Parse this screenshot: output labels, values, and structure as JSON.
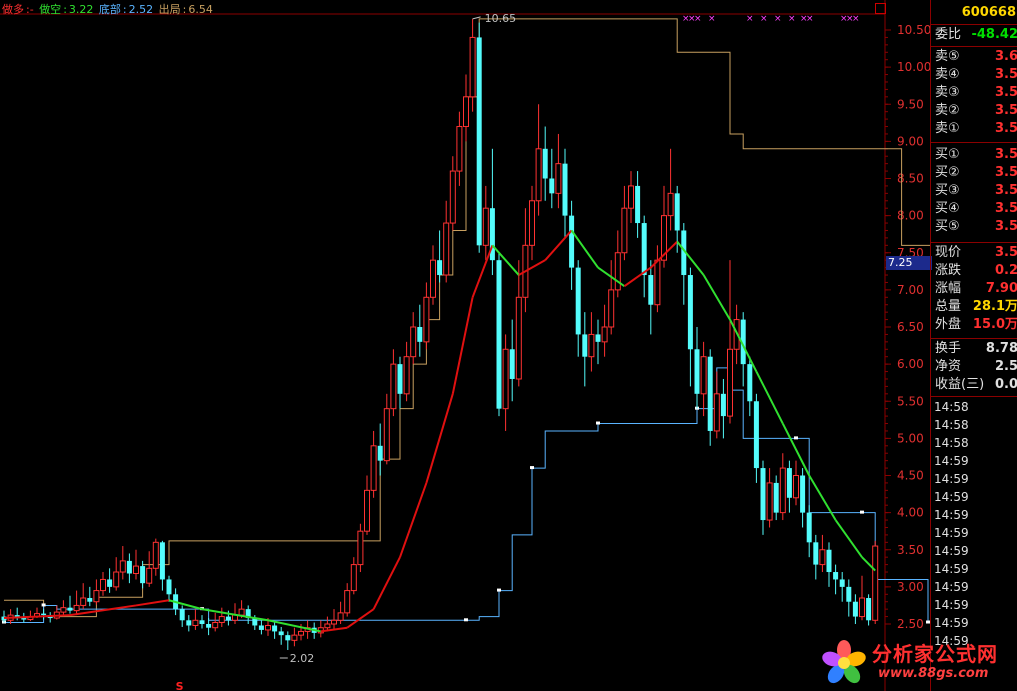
{
  "indicators": {
    "main_label": "做多",
    "main_sep": ":-",
    "short_label": "做空",
    "short_value": "3.22",
    "bottom_label": "底部",
    "bottom_value": "2.52",
    "exit_label": "出局",
    "exit_value": "6.54"
  },
  "price_axis": [
    "10.50",
    "10.00",
    "9.50",
    "9.00",
    "8.50",
    "8.00",
    "7.50",
    "7.00",
    "6.50",
    "6.00",
    "5.50",
    "5.00",
    "4.50",
    "4.00",
    "3.50",
    "3.00",
    "2.50"
  ],
  "annotations": {
    "high_label": "10.65",
    "low_label": "2.02",
    "marker_s": "S",
    "current_tag": "7.25",
    "x_marks": "×××  ×"
  },
  "quote": {
    "code": "600668",
    "rows": [
      {
        "label": "委比",
        "value": "-48.42",
        "color": "#00e000"
      },
      {
        "label": "卖⑤",
        "value": "3.6",
        "color": "#ff3030"
      },
      {
        "label": "卖④",
        "value": "3.5",
        "color": "#ff3030"
      },
      {
        "label": "卖③",
        "value": "3.5",
        "color": "#ff3030"
      },
      {
        "label": "卖②",
        "value": "3.5",
        "color": "#ff3030"
      },
      {
        "label": "卖①",
        "value": "3.5",
        "color": "#ff3030"
      },
      {
        "label": "买①",
        "value": "3.5",
        "color": "#ff3030"
      },
      {
        "label": "买②",
        "value": "3.5",
        "color": "#ff3030"
      },
      {
        "label": "买③",
        "value": "3.5",
        "color": "#ff3030"
      },
      {
        "label": "买④",
        "value": "3.5",
        "color": "#ff3030"
      },
      {
        "label": "买⑤",
        "value": "3.5",
        "color": "#ff3030"
      },
      {
        "label": "现价",
        "value": "3.5",
        "color": "#ff3030"
      },
      {
        "label": "涨跌",
        "value": "0.2",
        "color": "#ff3030"
      },
      {
        "label": "涨幅",
        "value": "7.90",
        "color": "#ff3030"
      },
      {
        "label": "总量",
        "value": "28.1万",
        "color": "#ffd700"
      },
      {
        "label": "外盘",
        "value": "15.0万",
        "color": "#ff3030"
      },
      {
        "label": "换手",
        "value": "8.78",
        "color": "#e0e0e0"
      },
      {
        "label": "净资",
        "value": "2.5",
        "color": "#e0e0e0"
      },
      {
        "label": "收益(三)",
        "value": "0.0",
        "color": "#e0e0e0"
      }
    ],
    "ticks": [
      "14:58",
      "14:58",
      "14:58",
      "14:59",
      "14:59",
      "14:59",
      "14:59",
      "14:59",
      "14:59",
      "14:59",
      "14:59",
      "14:59",
      "14:59",
      "14:59"
    ]
  },
  "watermark": {
    "title": "分析家公式网",
    "url": "www.88gs.com"
  },
  "colors": {
    "up": "#ff3232",
    "down": "#54fcfc",
    "ma_up": "#e01010",
    "ma_down": "#30e030",
    "exit_line": "#c8a060",
    "bottom_line": "#5ab4ff",
    "grid": "#8b0000",
    "marks": "#ff40ff"
  },
  "chart_data": {
    "type": "candlestick",
    "ylim": [
      2.0,
      10.8
    ],
    "candles": [
      [
        2.6,
        2.55,
        2.68,
        2.52
      ],
      [
        2.55,
        2.62,
        2.7,
        2.5
      ],
      [
        2.62,
        2.58,
        2.72,
        2.55
      ],
      [
        2.58,
        2.56,
        2.65,
        2.52
      ],
      [
        2.56,
        2.6,
        2.68,
        2.54
      ],
      [
        2.6,
        2.64,
        2.72,
        2.58
      ],
      [
        2.64,
        2.62,
        2.7,
        2.56
      ],
      [
        2.62,
        2.58,
        2.66,
        2.52
      ],
      [
        2.58,
        2.66,
        2.75,
        2.56
      ],
      [
        2.66,
        2.72,
        2.82,
        2.6
      ],
      [
        2.72,
        2.68,
        2.88,
        2.64
      ],
      [
        2.68,
        2.75,
        2.95,
        2.62
      ],
      [
        2.75,
        2.85,
        3.05,
        2.7
      ],
      [
        2.85,
        2.8,
        3.0,
        2.74
      ],
      [
        2.8,
        2.95,
        3.1,
        2.76
      ],
      [
        2.95,
        3.1,
        3.2,
        2.88
      ],
      [
        3.1,
        3.0,
        3.25,
        2.92
      ],
      [
        3.0,
        3.2,
        3.4,
        2.95
      ],
      [
        3.2,
        3.35,
        3.55,
        3.1
      ],
      [
        3.35,
        3.18,
        3.45,
        3.05
      ],
      [
        3.18,
        3.28,
        3.5,
        3.1
      ],
      [
        3.28,
        3.05,
        3.35,
        2.98
      ],
      [
        3.05,
        3.25,
        3.48,
        3.0
      ],
      [
        3.25,
        3.6,
        3.65,
        3.15
      ],
      [
        3.6,
        3.1,
        3.62,
        2.95
      ],
      [
        3.1,
        2.9,
        3.15,
        2.8
      ],
      [
        2.9,
        2.7,
        2.98,
        2.62
      ],
      [
        2.7,
        2.55,
        2.75,
        2.46
      ],
      [
        2.55,
        2.48,
        2.62,
        2.4
      ],
      [
        2.48,
        2.55,
        2.7,
        2.42
      ],
      [
        2.55,
        2.5,
        2.62,
        2.44
      ],
      [
        2.5,
        2.45,
        2.58,
        2.35
      ],
      [
        2.45,
        2.52,
        2.65,
        2.4
      ],
      [
        2.52,
        2.6,
        2.72,
        2.46
      ],
      [
        2.6,
        2.55,
        2.68,
        2.48
      ],
      [
        2.55,
        2.62,
        2.78,
        2.5
      ],
      [
        2.62,
        2.7,
        2.82,
        2.58
      ],
      [
        2.7,
        2.58,
        2.75,
        2.5
      ],
      [
        2.58,
        2.48,
        2.62,
        2.42
      ],
      [
        2.48,
        2.42,
        2.55,
        2.36
      ],
      [
        2.42,
        2.48,
        2.58,
        2.34
      ],
      [
        2.48,
        2.4,
        2.52,
        2.3
      ],
      [
        2.4,
        2.35,
        2.46,
        2.22
      ],
      [
        2.35,
        2.28,
        2.4,
        2.15
      ],
      [
        2.28,
        2.35,
        2.45,
        2.2
      ],
      [
        2.35,
        2.4,
        2.5,
        2.28
      ],
      [
        2.4,
        2.45,
        2.55,
        2.3
      ],
      [
        2.45,
        2.38,
        2.52,
        2.3
      ],
      [
        2.38,
        2.45,
        2.55,
        2.32
      ],
      [
        2.45,
        2.5,
        2.6,
        2.4
      ],
      [
        2.5,
        2.55,
        2.7,
        2.42
      ],
      [
        2.55,
        2.65,
        2.8,
        2.5
      ],
      [
        2.65,
        2.95,
        3.05,
        2.6
      ],
      [
        2.95,
        3.3,
        3.4,
        2.9
      ],
      [
        3.3,
        3.75,
        3.85,
        3.2
      ],
      [
        3.75,
        4.3,
        4.5,
        3.7
      ],
      [
        4.3,
        4.9,
        5.1,
        4.2
      ],
      [
        4.9,
        4.7,
        5.2,
        4.5
      ],
      [
        4.7,
        5.4,
        5.6,
        4.65
      ],
      [
        5.4,
        6.0,
        6.2,
        5.3
      ],
      [
        6.0,
        5.6,
        6.1,
        5.4
      ],
      [
        5.6,
        6.1,
        6.3,
        5.5
      ],
      [
        6.1,
        6.5,
        6.7,
        6.0
      ],
      [
        6.5,
        6.3,
        6.8,
        6.1
      ],
      [
        6.3,
        6.9,
        7.1,
        6.2
      ],
      [
        6.9,
        7.4,
        7.6,
        6.8
      ],
      [
        7.4,
        7.2,
        7.8,
        7.1
      ],
      [
        7.2,
        7.9,
        8.2,
        7.1
      ],
      [
        7.9,
        8.6,
        8.8,
        7.8
      ],
      [
        8.6,
        9.2,
        9.4,
        8.4
      ],
      [
        9.2,
        9.6,
        9.9,
        9.0
      ],
      [
        9.6,
        10.4,
        10.65,
        9.4
      ],
      [
        10.4,
        7.6,
        10.6,
        7.5
      ],
      [
        7.6,
        8.1,
        8.4,
        7.4
      ],
      [
        8.1,
        7.4,
        8.9,
        7.2
      ],
      [
        7.4,
        5.4,
        7.5,
        5.3
      ],
      [
        5.4,
        6.2,
        6.4,
        5.1
      ],
      [
        6.2,
        5.8,
        6.6,
        5.5
      ],
      [
        5.8,
        6.9,
        7.4,
        5.7
      ],
      [
        6.9,
        7.6,
        8.1,
        6.7
      ],
      [
        7.6,
        8.2,
        8.4,
        7.4
      ],
      [
        8.2,
        8.9,
        9.5,
        8.0
      ],
      [
        8.9,
        8.5,
        9.2,
        8.2
      ],
      [
        8.5,
        8.3,
        8.9,
        8.1
      ],
      [
        8.3,
        8.7,
        9.1,
        8.1
      ],
      [
        8.7,
        8.0,
        8.9,
        7.7
      ],
      [
        8.0,
        7.3,
        8.2,
        7.0
      ],
      [
        7.3,
        6.4,
        7.4,
        6.1
      ],
      [
        6.4,
        6.1,
        6.7,
        5.7
      ],
      [
        6.1,
        6.4,
        6.7,
        5.9
      ],
      [
        6.4,
        6.3,
        6.6,
        6.0
      ],
      [
        6.3,
        6.5,
        6.8,
        6.1
      ],
      [
        6.5,
        7.0,
        7.4,
        6.4
      ],
      [
        7.0,
        7.5,
        7.8,
        6.9
      ],
      [
        7.5,
        8.1,
        8.4,
        7.4
      ],
      [
        8.1,
        8.4,
        8.6,
        7.9
      ],
      [
        8.4,
        7.9,
        8.6,
        7.7
      ],
      [
        7.9,
        7.2,
        8.0,
        6.9
      ],
      [
        7.2,
        6.8,
        7.4,
        6.4
      ],
      [
        6.8,
        7.4,
        7.6,
        6.7
      ],
      [
        7.4,
        8.0,
        8.4,
        7.3
      ],
      [
        8.0,
        8.3,
        8.9,
        7.8
      ],
      [
        8.3,
        7.8,
        8.4,
        7.5
      ],
      [
        7.8,
        7.2,
        7.9,
        6.8
      ],
      [
        7.2,
        6.2,
        7.3,
        5.7
      ],
      [
        6.2,
        5.6,
        6.5,
        5.4
      ],
      [
        5.6,
        6.1,
        6.3,
        5.3
      ],
      [
        6.1,
        5.1,
        6.2,
        4.9
      ],
      [
        5.1,
        5.6,
        5.9,
        5.0
      ],
      [
        5.6,
        5.3,
        5.8,
        5.0
      ],
      [
        5.3,
        6.2,
        7.4,
        5.2
      ],
      [
        6.2,
        6.6,
        6.8,
        6.0
      ],
      [
        6.6,
        6.0,
        6.7,
        5.7
      ],
      [
        6.0,
        5.5,
        6.1,
        5.3
      ],
      [
        5.5,
        4.6,
        5.6,
        4.4
      ],
      [
        4.6,
        3.9,
        4.7,
        3.7
      ],
      [
        3.9,
        4.4,
        4.6,
        3.8
      ],
      [
        4.4,
        4.0,
        4.5,
        3.9
      ],
      [
        4.0,
        4.6,
        4.8,
        3.9
      ],
      [
        4.6,
        4.2,
        4.7,
        4.0
      ],
      [
        4.2,
        4.5,
        4.7,
        4.1
      ],
      [
        4.5,
        4.0,
        4.6,
        3.8
      ],
      [
        4.0,
        3.6,
        4.1,
        3.4
      ],
      [
        3.6,
        3.3,
        3.7,
        3.1
      ],
      [
        3.3,
        3.5,
        3.7,
        3.2
      ],
      [
        3.5,
        3.2,
        3.6,
        3.0
      ],
      [
        3.2,
        3.1,
        3.3,
        2.9
      ],
      [
        3.1,
        3.0,
        3.2,
        2.8
      ],
      [
        3.0,
        2.8,
        3.1,
        2.6
      ],
      [
        2.8,
        2.6,
        2.9,
        2.5
      ],
      [
        2.6,
        2.85,
        3.15,
        2.55
      ],
      [
        2.85,
        2.55,
        2.9,
        2.48
      ],
      [
        2.55,
        3.55,
        3.62,
        2.5
      ]
    ],
    "ma": [
      [
        0,
        2.58
      ],
      [
        10,
        2.62
      ],
      [
        20,
        2.75
      ],
      [
        25,
        2.82
      ],
      [
        30,
        2.7
      ],
      [
        40,
        2.55
      ],
      [
        48,
        2.4
      ],
      [
        52,
        2.45
      ],
      [
        56,
        2.7
      ],
      [
        60,
        3.4
      ],
      [
        64,
        4.4
      ],
      [
        68,
        5.6
      ],
      [
        71,
        6.9
      ],
      [
        74,
        7.6
      ],
      [
        78,
        7.2
      ],
      [
        82,
        7.4
      ],
      [
        86,
        7.8
      ],
      [
        90,
        7.3
      ],
      [
        94,
        7.05
      ],
      [
        98,
        7.3
      ],
      [
        102,
        7.65
      ],
      [
        106,
        7.2
      ],
      [
        110,
        6.6
      ],
      [
        114,
        5.9
      ],
      [
        118,
        5.2
      ],
      [
        122,
        4.5
      ],
      [
        126,
        3.9
      ],
      [
        130,
        3.4
      ],
      [
        132,
        3.22
      ]
    ],
    "exit": [
      [
        0,
        2.82
      ],
      [
        5,
        2.82
      ],
      [
        6,
        2.6
      ],
      [
        13,
        2.6
      ],
      [
        14,
        2.86
      ],
      [
        20,
        2.86
      ],
      [
        21,
        3.3
      ],
      [
        24,
        3.3
      ],
      [
        25,
        3.62
      ],
      [
        56,
        3.62
      ],
      [
        57,
        4.72
      ],
      [
        60,
        5.4
      ],
      [
        62,
        6.0
      ],
      [
        64,
        6.6
      ],
      [
        66,
        7.2
      ],
      [
        68,
        7.8
      ],
      [
        70,
        9.6
      ],
      [
        72,
        10.65
      ],
      [
        100,
        10.65
      ],
      [
        102,
        10.2
      ],
      [
        108,
        10.2
      ],
      [
        110,
        9.1
      ],
      [
        112,
        8.9
      ],
      [
        132,
        8.9
      ],
      [
        136,
        7.6
      ],
      [
        142,
        7.6
      ],
      [
        144,
        6.54
      ]
    ],
    "bottom": [
      [
        0,
        2.52
      ],
      [
        4,
        2.52
      ],
      [
        6,
        2.75
      ],
      [
        8,
        2.7
      ],
      [
        30,
        2.7
      ],
      [
        31,
        2.55
      ],
      [
        70,
        2.55
      ],
      [
        72,
        2.6
      ],
      [
        75,
        2.95
      ],
      [
        77,
        3.7
      ],
      [
        80,
        4.6
      ],
      [
        82,
        5.1
      ],
      [
        90,
        5.2
      ],
      [
        103,
        5.2
      ],
      [
        105,
        5.4
      ],
      [
        108,
        5.95
      ],
      [
        110,
        5.65
      ],
      [
        112,
        5.0
      ],
      [
        120,
        5.0
      ],
      [
        122,
        4.0
      ],
      [
        130,
        4.0
      ],
      [
        132,
        3.1
      ],
      [
        140,
        2.52
      ]
    ]
  }
}
